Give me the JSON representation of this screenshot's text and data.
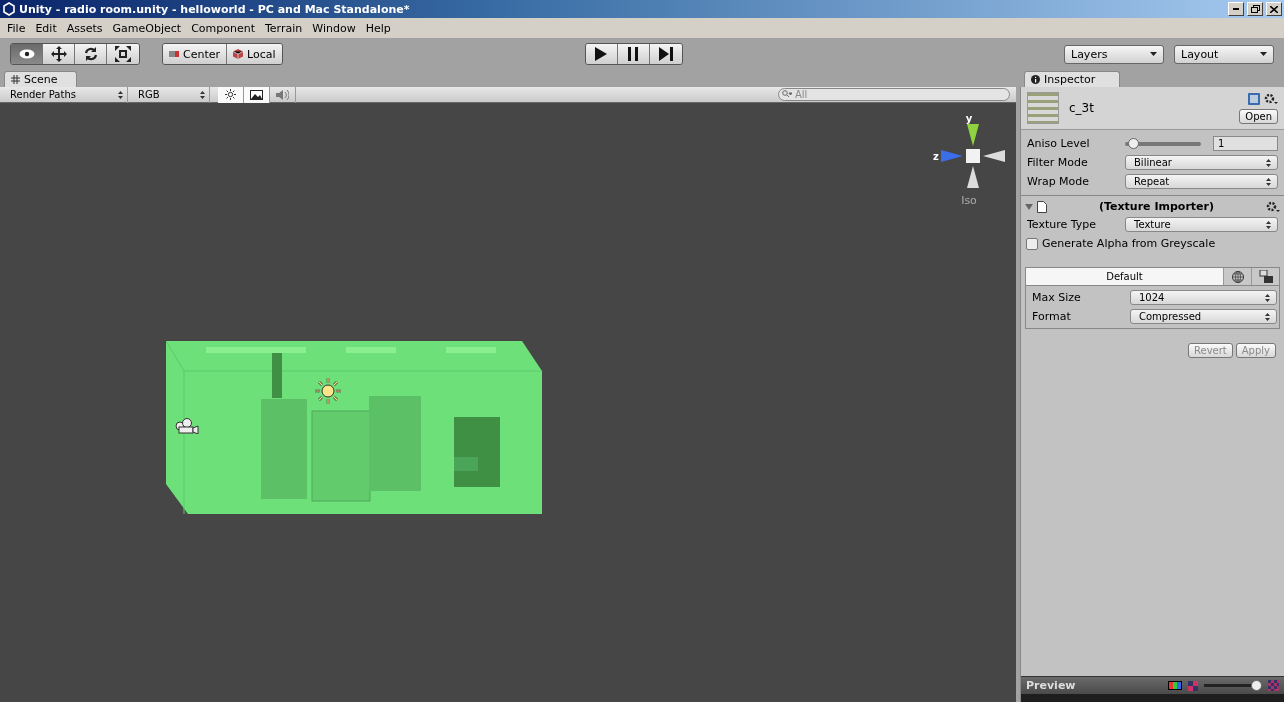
{
  "window": {
    "title": "Unity - radio room.unity - helloworld - PC and Mac Standalone*"
  },
  "menu": [
    "File",
    "Edit",
    "Assets",
    "GameObject",
    "Component",
    "Terrain",
    "Window",
    "Help"
  ],
  "toolbar": {
    "tools": [
      {
        "kind": "view",
        "selected": true
      },
      {
        "kind": "move",
        "selected": false
      },
      {
        "kind": "rotate",
        "selected": false
      },
      {
        "kind": "scale",
        "selected": false
      }
    ],
    "pivot": [
      {
        "kind": "pivot",
        "label": "Center"
      },
      {
        "kind": "space",
        "label": "Local"
      }
    ],
    "playback": [
      {
        "kind": "play",
        "on": false
      },
      {
        "kind": "pause",
        "on": false
      },
      {
        "kind": "step",
        "on": false
      }
    ],
    "dropdowns": [
      "Layers",
      "Layout"
    ]
  },
  "scene": {
    "tab": "Scene",
    "render_mode": "Render Paths",
    "channel": "RGB",
    "toggles": [
      {
        "kind": "lighting",
        "on": true
      },
      {
        "kind": "image",
        "on": true
      },
      {
        "kind": "audio",
        "on": false
      }
    ],
    "search": {
      "placeholder": "All"
    },
    "gizmo": {
      "y": "y",
      "z": "z",
      "projection": "Iso"
    }
  },
  "inspector": {
    "tab": "Inspector",
    "asset": "c_3t",
    "open": "Open",
    "properties": [
      {
        "kind": "slider",
        "label": "Aniso Level",
        "level": 0.1,
        "value": "1"
      },
      {
        "kind": "dropdown",
        "label": "Filter Mode",
        "value": "Bilinear"
      },
      {
        "kind": "dropdown",
        "label": "Wrap Mode",
        "value": "Repeat"
      }
    ],
    "importer": {
      "title": "(Texture Importer)",
      "expanded": true,
      "texture_type_label": "Texture Type",
      "texture_type": "Texture",
      "checkbox": {
        "label": "Generate Alpha from Greyscale",
        "checked": false
      },
      "platforms": [
        {
          "kind": "default",
          "label": "Default",
          "selected": true
        },
        {
          "kind": "web",
          "selected": false
        },
        {
          "kind": "standalone",
          "selected": false
        }
      ],
      "settings": [
        {
          "label": "Max Size",
          "value": "1024"
        },
        {
          "label": "Format",
          "value": "Compressed"
        }
      ],
      "buttons": [
        {
          "label": "Revert",
          "disabled": true
        },
        {
          "label": "Apply",
          "disabled": true
        }
      ]
    },
    "preview": {
      "title": "Preview",
      "level": 0.9
    }
  }
}
